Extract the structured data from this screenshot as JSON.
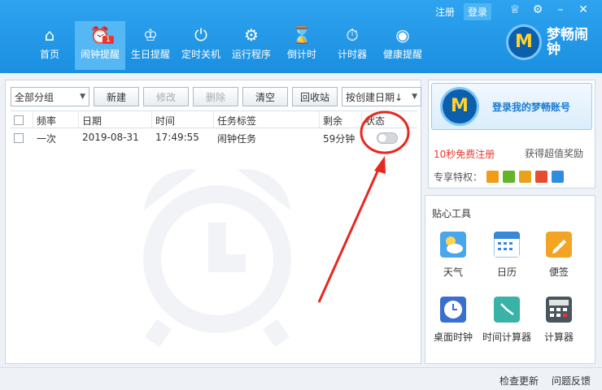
{
  "header": {
    "auth": {
      "register": "注册",
      "login": "登录"
    },
    "nav": [
      {
        "label": "首页",
        "icon": "home-icon",
        "glyph": "⌂"
      },
      {
        "label": "闹钟提醒",
        "icon": "alarm-clock-icon",
        "glyph": "⏰",
        "badge": "1"
      },
      {
        "label": "生日提醒",
        "icon": "birthday-cake-icon",
        "glyph": "♔"
      },
      {
        "label": "定时关机",
        "icon": "power-icon",
        "glyph": "⏻"
      },
      {
        "label": "运行程序",
        "icon": "gear-icon",
        "glyph": "⚙"
      },
      {
        "label": "倒计时",
        "icon": "hourglass-icon",
        "glyph": "⌛"
      },
      {
        "label": "计时器",
        "icon": "stopwatch-icon",
        "glyph": "⏱"
      },
      {
        "label": "健康提醒",
        "icon": "eye-icon",
        "glyph": "◉"
      }
    ],
    "brand": {
      "name": "梦畅闹钟",
      "logo_letter": "M"
    }
  },
  "toolbar": {
    "group_select": "全部分组",
    "new_label": "新建",
    "edit_label": "修改",
    "delete_label": "删除",
    "clear_label": "清空",
    "recycle_label": "回收站",
    "sort_select": "按创建日期↓"
  },
  "table": {
    "columns": [
      "频率",
      "日期",
      "时间",
      "任务标签",
      "剩余",
      "状态"
    ],
    "rows": [
      {
        "frequency": "一次",
        "date": "2019-08-31",
        "time": "17:49:55",
        "task": "闹钟任务",
        "remaining": "59分钟",
        "status": "off"
      }
    ]
  },
  "account": {
    "login_text": "登录我的梦畅账号",
    "register_text": "10秒免费注册",
    "reward_text": "获得超值奖励",
    "privilege_label": "专享特权：",
    "privilege_colors": [
      "#f29b16",
      "#63b42b",
      "#e8a21c",
      "#e84b2f",
      "#2f8de0"
    ]
  },
  "tools": {
    "title": "贴心工具",
    "items": [
      {
        "label": "天气",
        "icon": "weather-icon",
        "color": "#4aa6ec"
      },
      {
        "label": "日历",
        "icon": "calendar-icon",
        "color": "#3a86d8"
      },
      {
        "label": "便签",
        "icon": "note-icon",
        "color": "#f4a424"
      },
      {
        "label": "桌面时钟",
        "icon": "desktop-clock-icon",
        "color": "#3b6fcf"
      },
      {
        "label": "时间计算器",
        "icon": "time-calculator-icon",
        "color": "#39b3a8"
      },
      {
        "label": "计算器",
        "icon": "calculator-icon",
        "color": "#4a5560"
      }
    ]
  },
  "status_bar": {
    "check_update": "检查更新",
    "feedback": "问题反馈"
  },
  "colors": {
    "header": "#1f95e4",
    "accent_red": "#e8372f"
  }
}
